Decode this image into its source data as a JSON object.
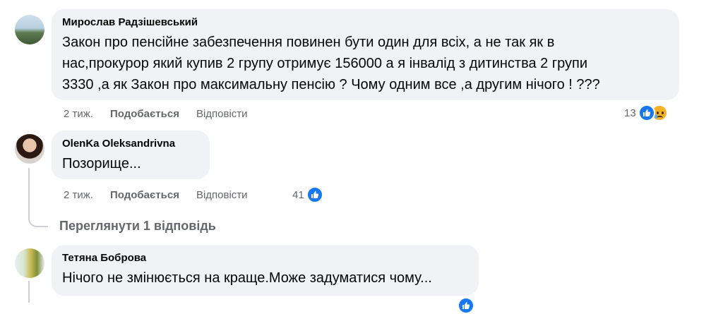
{
  "comments": [
    {
      "author": "Мирослав Радзішевський",
      "text": "Закон про пенсійне забезпечення повинен бути один для всіх, а не так як в\nнас,прокурор який купив 2 групу отримує 156000 а я інвалід з дитинства 2 групи\n3330 ,а як Закон про максимальну пенсію ? Чому одним все ,а другим нічого ! ???",
      "time": "2 тиж.",
      "like_label": "Подобається",
      "reply_label": "Відповісти",
      "reaction_count": "13",
      "reactions": [
        "like-icon",
        "sad-icon"
      ]
    },
    {
      "author": "OlenKa Oleksandrivna",
      "text": "Позорище...",
      "time": "2 тиж.",
      "like_label": "Подобається",
      "reply_label": "Відповісти",
      "reaction_count": "41",
      "reactions": [
        "like-icon"
      ],
      "view_replies": "Переглянути 1 відповідь"
    },
    {
      "author": "Тетяна Боброва",
      "text": "Нічого не змінюється на краще.Може задуматися чому...",
      "reactions": [
        "like-icon"
      ]
    }
  ],
  "colors": {
    "bubble": "#f0f2f5",
    "meta": "#65676b",
    "like_blue": "#1877f2",
    "sad_yellow": "#f7b125"
  }
}
